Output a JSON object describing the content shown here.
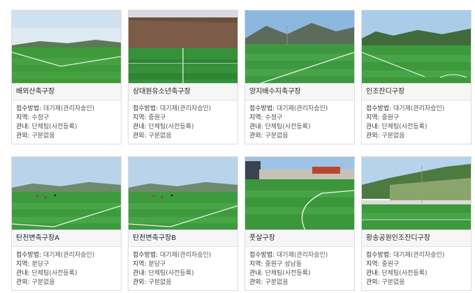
{
  "labels": {
    "method": "접수방법: ",
    "region": "지역: ",
    "admin": "관내: ",
    "outside": "관외: "
  },
  "fields": [
    {
      "name": "배뫼산축구장",
      "method": "대기제(관리자승인)",
      "region": "수정구",
      "admin": "단체팀(사전등록)",
      "outside": "구분없음",
      "photo": "field-photo-1"
    },
    {
      "name": "상대원유소년축구장",
      "method": "대기제(관리자승인)",
      "region": "중원구",
      "admin": "단체팀(사전등록)",
      "outside": "구분없음",
      "photo": "field-photo-2"
    },
    {
      "name": "양지배수지축구장",
      "method": "대기제(관리자승인)",
      "region": "수정구",
      "admin": "단체팀(사전등록)",
      "outside": "구분없음",
      "photo": "field-photo-3"
    },
    {
      "name": "인조잔디구장",
      "method": "대기제(관리자승인)",
      "region": "중원구",
      "admin": "단체팀(사전등록)",
      "outside": "구분없음",
      "photo": "field-photo-4"
    },
    {
      "name": "탄천변축구장A",
      "method": "대기제(관리자승인)",
      "region": "분당구",
      "admin": "단체팀(사전등록)",
      "outside": "구분없음",
      "photo": "field-photo-5"
    },
    {
      "name": "탄천변축구장B",
      "method": "대기제(관리자승인)",
      "region": "분당구",
      "admin": "단체팀(사전등록)",
      "outside": "구분없음",
      "photo": "field-photo-6"
    },
    {
      "name": "풋살구장",
      "method": "대기제(관리자승인)",
      "region": "중원구 성남동",
      "admin": "단체팀(사전등록)",
      "outside": "구분없음",
      "photo": "field-photo-7"
    },
    {
      "name": "황송공원인조잔디구장",
      "method": "대기제(관리자승인)",
      "region": "중원구",
      "admin": "단체팀(사전등록)",
      "outside": "구분없음",
      "photo": "field-photo-8"
    }
  ],
  "colors": {
    "sky": "#cfe0ef",
    "grass": "#3f9a3a",
    "grass_dark": "#2f7f2c",
    "card_border": "#dcdcdc"
  }
}
